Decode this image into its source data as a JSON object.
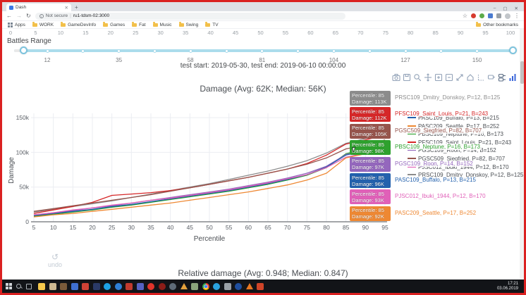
{
  "browser": {
    "tab_title": "Dash",
    "new_tab_label": "+",
    "url_security": "Not secure",
    "url": "ru1-tdsm-02:3000",
    "bookmarks": [
      "Apps",
      "WORK",
      "GameDevInfo",
      "Games",
      "Fat",
      "Music",
      "Swing",
      "TV"
    ],
    "other_bookmarks": "Other bookmarks",
    "window_controls": {
      "minimize": "–",
      "maximize": "▢",
      "close": "✕"
    }
  },
  "page": {
    "percentile_ruler": [
      0,
      5,
      10,
      15,
      20,
      25,
      30,
      35,
      40,
      45,
      50,
      55,
      60,
      65,
      70,
      75,
      80,
      85,
      90,
      95,
      100
    ],
    "battles_range_label": "Battles Range",
    "battles_slider_labels": [
      "12",
      "35",
      "58",
      "81",
      "104",
      "127",
      "150"
    ],
    "test_range": "test start: 2019-05-30, test end: 2019-06-10 00:00:00",
    "undo_label": "undo",
    "relative_title": "Relative damage (Avg: 0.948; Median: 0.847)"
  },
  "modebar_buttons": [
    "download-plot-camera",
    "save-snapshot",
    "zoom",
    "pan",
    "zoom-in",
    "zoom-out",
    "autoscale",
    "reset-axes",
    "toggle-spike-lines",
    "show-closest-on-hover",
    "compare-data-on-hover",
    "plotly-logo"
  ],
  "chart_data": {
    "type": "line",
    "title": "Damage (Avg: 62K; Median: 56K)",
    "xlabel": "Percentile",
    "ylabel": "Damage",
    "x": [
      5,
      10,
      15,
      20,
      25,
      30,
      35,
      40,
      45,
      50,
      55,
      60,
      65,
      70,
      75,
      80,
      85,
      90,
      95
    ],
    "xlim": [
      5,
      95
    ],
    "ylim": [
      0,
      155
    ],
    "y_units": "thousands of damage",
    "yticks": [
      0,
      50,
      100,
      150
    ],
    "ytick_labels": [
      "0",
      "50k",
      "100k",
      "150k"
    ],
    "grid": true,
    "legend_position": "right",
    "series": [
      {
        "name": "PRSC109_Dmitry_Donskoy, P=12, B=125",
        "color": "#8c8c8c",
        "values": [
          14,
          18,
          22,
          26,
          30,
          35,
          40,
          45,
          50,
          55,
          61,
          67,
          73,
          80,
          88,
          99,
          113,
          120,
          127
        ]
      },
      {
        "name": "PFSC109_Saint_Louis, P=21, B=243",
        "color": "#d62728",
        "values": [
          12,
          17,
          22,
          28,
          38,
          40,
          42,
          45,
          49,
          54,
          59,
          64,
          70,
          76,
          84,
          96,
          112,
          118,
          125
        ]
      },
      {
        "name": "PGSC509_Siegfried, P=82, B=707",
        "color": "#96544c",
        "values": [
          15,
          19,
          23,
          27,
          31,
          35,
          39,
          44,
          49,
          54,
          59,
          64,
          70,
          76,
          83,
          92,
          105,
          111,
          118
        ]
      },
      {
        "name": "PBSC109_Neptune, P=16, B=173",
        "color": "#2ea12e",
        "values": [
          8,
          11,
          14,
          17,
          21,
          24,
          28,
          32,
          36,
          40,
          44,
          49,
          54,
          60,
          67,
          78,
          98,
          105,
          112
        ]
      },
      {
        "name": "PGSC109_Roon, P=14, B=152",
        "color": "#9467bd",
        "values": [
          10,
          13,
          16,
          20,
          23,
          27,
          31,
          35,
          39,
          43,
          47,
          52,
          57,
          63,
          70,
          80,
          97,
          103,
          110
        ]
      },
      {
        "name": "PASC109_Buffalo, P=13, B=215",
        "color": "#2361ad",
        "values": [
          9,
          12,
          15,
          18,
          22,
          25,
          29,
          33,
          37,
          41,
          45,
          50,
          55,
          61,
          68,
          79,
          96,
          102,
          109
        ]
      },
      {
        "name": "PJSC012_Ibuki_1944, P=12, B=170",
        "color": "#e060b8",
        "values": [
          10,
          13,
          17,
          20,
          24,
          27,
          31,
          34,
          38,
          42,
          46,
          51,
          56,
          62,
          68,
          78,
          93,
          99,
          105
        ]
      },
      {
        "name": "PASC209_Seattle, P=17, B=252",
        "color": "#ee8833",
        "values": [
          7,
          10,
          12,
          15,
          18,
          21,
          24,
          27,
          31,
          35,
          39,
          43,
          48,
          53,
          60,
          70,
          92,
          98,
          104
        ]
      }
    ]
  },
  "hover_labels": {
    "x_text": "Percentile: 85",
    "items": [
      {
        "value_text": "Damage: 113K",
        "color": "#8c8c8c",
        "name": "PRSC109_Dmitry_Donskoy, P=12, B=125"
      },
      {
        "value_text": "Damage: 112K",
        "color": "#d62728",
        "name": "PFSC109_Saint_Louis, P=21, B=243"
      },
      {
        "value_text": "Damage: 105K",
        "color": "#96544c",
        "name": "PGSC509_Siegfried, P=82, B=707"
      },
      {
        "value_text": "Damage: 98K",
        "color": "#2ea12e",
        "name": "PBSC109_Neptune, P=16, B=173"
      },
      {
        "value_text": "Damage: 97K",
        "color": "#9467bd",
        "name": "PGSC109_Roon, P=14, B=152"
      },
      {
        "value_text": "Damage: 96K",
        "color": "#2361ad",
        "name": "PASC109_Buffalo, P=13, B=215"
      },
      {
        "value_text": "Damage: 93K",
        "color": "#e060b8",
        "name": "PJSC012_Ibuki_1944, P=12, B=170"
      },
      {
        "value_text": "Damage: 92K",
        "color": "#ee8833",
        "name": "PASC209_Seattle, P=17, B=252"
      }
    ]
  },
  "legend_items": [
    {
      "name": "PASC109_Buffalo, P=13, B=215",
      "color": "#2361ad"
    },
    {
      "name": "PASC209_Seattle, P=17, B=252",
      "color": "#ee8833"
    },
    {
      "name": "PBSC109_Neptune, P=16, B=173",
      "color": "#2ea12e"
    },
    {
      "name": "PFSC109_Saint_Louis, P=21, B=243",
      "color": "#d62728"
    },
    {
      "name": "PGSC109_Roon, P=14, B=152",
      "color": "#9467bd"
    },
    {
      "name": "PGSC509_Siegfried, P=82, B=707",
      "color": "#96544c"
    },
    {
      "name": "PJSC012_Ibuki_1944, P=12, B=170",
      "color": "#e060b8"
    },
    {
      "name": "PRSC109_Dmitry_Donskoy, P=12, B=125",
      "color": "#8c8c8c"
    }
  ],
  "taskbar": {
    "clock_time": "17:21",
    "clock_date": "03.06.2019",
    "apps": [
      {
        "name": "file-explorer",
        "color": "#f5c84c",
        "shape": "square"
      },
      {
        "name": "archive-app",
        "color": "#cdb891",
        "shape": "square"
      },
      {
        "name": "briefcase-app",
        "color": "#7a5a3a",
        "shape": "square"
      },
      {
        "name": "blue-app",
        "color": "#3f6fd1",
        "shape": "square"
      },
      {
        "name": "red-blue-app",
        "color": "#cf4236",
        "shape": "square"
      },
      {
        "name": "navy-app",
        "color": "#2b3a67",
        "shape": "square"
      },
      {
        "name": "skype",
        "color": "#1da1e3",
        "shape": "circle"
      },
      {
        "name": "blue-circle-app",
        "color": "#2f7fd6",
        "shape": "circle"
      },
      {
        "name": "red-editor-app",
        "color": "#c23a2e",
        "shape": "square"
      },
      {
        "name": "purple-app",
        "color": "#5561c2",
        "shape": "square"
      },
      {
        "name": "red-circle-app",
        "color": "#e0342b",
        "shape": "circle"
      },
      {
        "name": "dark-red-app",
        "color": "#8c1d18",
        "shape": "circle"
      },
      {
        "name": "gray-ball-app",
        "color": "#5e6b78",
        "shape": "circle"
      },
      {
        "name": "warning-triangle-app",
        "color": "#e5a13c",
        "shape": "triangle"
      },
      {
        "name": "sage-app",
        "color": "#8aa37b",
        "shape": "square"
      },
      {
        "name": "chrome",
        "color": "chrome",
        "shape": "chrome"
      },
      {
        "name": "teal-app",
        "color": "#2aa3df",
        "shape": "circle"
      },
      {
        "name": "gray-small-app",
        "color": "#9aa0a6",
        "shape": "square"
      },
      {
        "name": "blue-q-app",
        "color": "#1f4e9e",
        "shape": "circle"
      },
      {
        "name": "vlc",
        "color": "#e87722",
        "shape": "triangle"
      },
      {
        "name": "p3-app",
        "color": "#cf4428",
        "shape": "square"
      }
    ]
  },
  "colors": {
    "screen_border": "#da2121",
    "slider_track": "#abdcec",
    "modebar_icon": "#93a3b8",
    "plotly_logo": "#3a66d9"
  }
}
